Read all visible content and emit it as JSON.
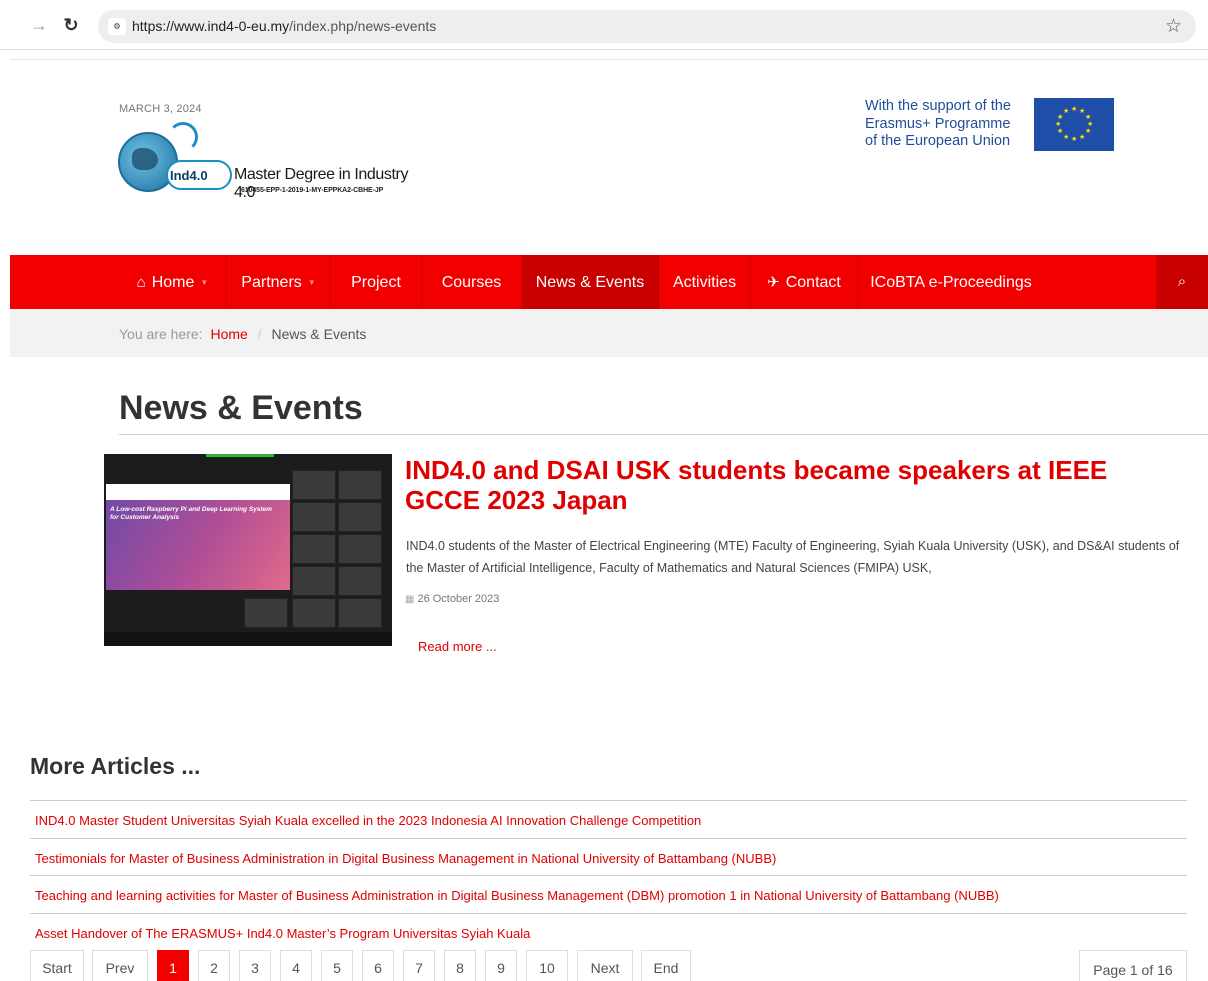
{
  "browser": {
    "url_host": "https://www.ind4-0-eu.my",
    "url_path": "/index.php/news-events",
    "back_icon": "arrow-right-icon",
    "reload_icon": "reload-icon",
    "bookmark_icon": "star-icon"
  },
  "header": {
    "date": "MARCH 3, 2024",
    "logo_badge": "Ind4.0",
    "logo_title": "Master Degree in Industry 4.0",
    "logo_code": "610455-EPP-1-2019-1-MY-EPPKA2-CBHE-JP",
    "eu_support_line1": "With the support of the",
    "eu_support_line2": "Erasmus+ Programme",
    "eu_support_line3": "of the European Union"
  },
  "nav": {
    "items": [
      {
        "label": "Home",
        "icon": "home-icon"
      },
      {
        "label": "Partners"
      },
      {
        "label": "Project"
      },
      {
        "label": "Courses"
      },
      {
        "label": "News & Events"
      },
      {
        "label": "Activities"
      },
      {
        "label": "Contact",
        "icon": "paper-plane-icon"
      },
      {
        "label": "ICoBTA e-Proceedings"
      }
    ],
    "search_icon": "search-icon",
    "accent": "#f20000",
    "active_bg": "#c80000"
  },
  "breadcrumb": {
    "prefix": "You are here:",
    "home": "Home",
    "current": "News & Events"
  },
  "page": {
    "title": "News & Events"
  },
  "featured": {
    "slide_text_1": "A Low-cost Raspberry Pi and Deep Learning System",
    "slide_text_2": "for Customer Analysis",
    "title": "IND4.0 and DSAI USK students became speakers at IEEE GCCE 2023 Japan",
    "intro": "IND4.0 students of the Master of Electrical Engineering (MTE) Faculty of Engineering, Syiah Kuala University (USK), and DS&AI students of the Master of Artificial Intelligence, Faculty of Mathematics and Natural Sciences (FMIPA) USK,",
    "date": "26 October 2023",
    "read_more": "Read more ..."
  },
  "more_articles": {
    "title": "More Articles ...",
    "items": [
      "IND4.0 Master Student Universitas Syiah Kuala excelled in the 2023 Indonesia AI Innovation Challenge Competition",
      "Testimonials for Master of Business Administration in Digital Business Management in National University of Battambang (NUBB)",
      "Teaching and learning activities for Master of Business Administration in Digital Business Management (DBM) promotion 1 in National University of Battambang (NUBB)",
      "Asset Handover of The ERASMUS+ Ind4.0 Master’s Program Universitas Syiah Kuala"
    ]
  },
  "pagination": {
    "start": "Start",
    "prev": "Prev",
    "pages": [
      "1",
      "2",
      "3",
      "4",
      "5",
      "6",
      "7",
      "8",
      "9",
      "10"
    ],
    "next": "Next",
    "end": "End",
    "page_of": "Page 1 of 16"
  }
}
